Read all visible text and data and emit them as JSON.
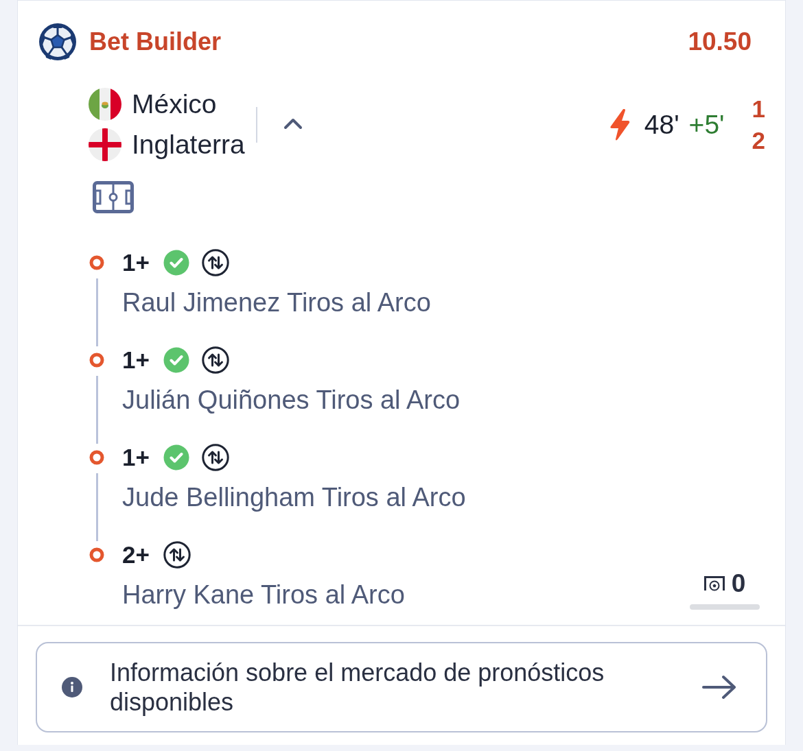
{
  "header": {
    "title": "Bet Builder",
    "odds": "10.50"
  },
  "match": {
    "teams": [
      {
        "name": "México",
        "kind": "mexico"
      },
      {
        "name": "Inglaterra",
        "kind": "england"
      }
    ],
    "expanded": true,
    "live": true,
    "clock": "48'",
    "added_time": "+5'",
    "scores": [
      "1",
      "2"
    ]
  },
  "selections": [
    {
      "line": "1+",
      "won": true,
      "market": "Raul Jimenez Tiros al Arco"
    },
    {
      "line": "1+",
      "won": true,
      "market": "Julián Quiñones Tiros al Arco"
    },
    {
      "line": "1+",
      "won": true,
      "market": "Jude Bellingham Tiros al Arco"
    },
    {
      "line": "2+",
      "won": false,
      "market": "Harry Kane Tiros al Arco"
    }
  ],
  "goal_counter": {
    "count": "0"
  },
  "info_button": {
    "label": "Información sobre el mercado de pronósticos disponibles"
  }
}
